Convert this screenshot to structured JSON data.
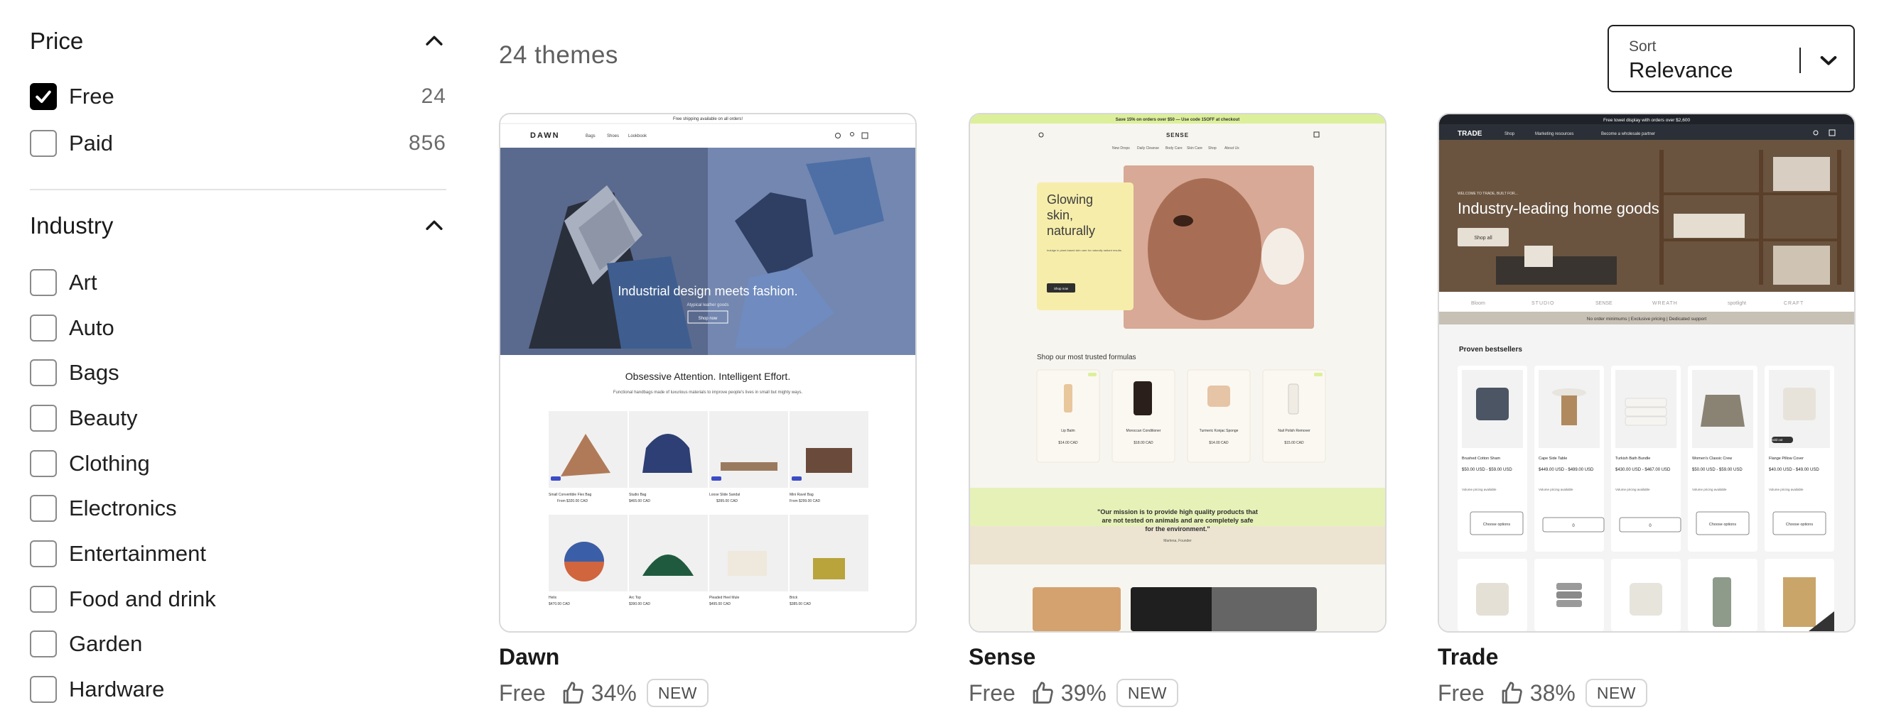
{
  "filters": {
    "price": {
      "title": "Price",
      "options": [
        {
          "label": "Free",
          "count": "24",
          "checked": true
        },
        {
          "label": "Paid",
          "count": "856",
          "checked": false
        }
      ]
    },
    "industry": {
      "title": "Industry",
      "options": [
        {
          "label": "Art"
        },
        {
          "label": "Auto"
        },
        {
          "label": "Bags"
        },
        {
          "label": "Beauty"
        },
        {
          "label": "Clothing"
        },
        {
          "label": "Electronics"
        },
        {
          "label": "Entertainment"
        },
        {
          "label": "Food and drink"
        },
        {
          "label": "Garden"
        },
        {
          "label": "Hardware"
        }
      ]
    }
  },
  "results": {
    "count_label": "24 themes"
  },
  "sort": {
    "caption": "Sort",
    "value": "Relevance"
  },
  "themes": [
    {
      "name": "Dawn",
      "price": "Free",
      "rating": "34%",
      "badge": "NEW",
      "preview": {
        "announcement": "Free shipping available on all orders!",
        "logo": "DAWN",
        "nav": [
          "Bags",
          "Shoes",
          "Lookbook"
        ],
        "hero_title": "Industrial design meets fashion.",
        "hero_sub": "Atypical leather goods",
        "hero_button": "Shop now",
        "section_title": "Obsessive Attention. Intelligent Effort.",
        "section_text": "Functional handbags made of luxurious materials to improve people's lives in small but mighty ways.",
        "products": [
          {
            "name": "Small Convertible Flex Bag",
            "price": "From $320.00 CAD"
          },
          {
            "name": "Studio Bag",
            "price": "$465.00 CAD"
          },
          {
            "name": "Loose Slide Sandal",
            "price": "$395.00 CAD"
          },
          {
            "name": "Mini Ravel Bag",
            "price": "From $299.00 CAD"
          },
          {
            "name": "Helix",
            "price": "$470.00 CAD"
          },
          {
            "name": "Arc Top",
            "price": "$390.00 CAD"
          },
          {
            "name": "Pleaded Heel Mule",
            "price": "$495.00 CAD"
          },
          {
            "name": "Brick",
            "price": "$385.00 CAD"
          }
        ]
      }
    },
    {
      "name": "Sense",
      "price": "Free",
      "rating": "39%",
      "badge": "NEW",
      "preview": {
        "announcement": "Save 15% on orders over $50 — Use code 15OFF at checkout",
        "logo": "SENSE",
        "nav": [
          "New Drops",
          "Daily Cleanse",
          "Body Care",
          "Skin Care",
          "Shop",
          "About Us"
        ],
        "hero_title_lines": [
          "Glowing",
          "skin,",
          "naturally"
        ],
        "hero_text": "Indulge in plant-based skin care for naturally radiant results.",
        "hero_button": "Shop now",
        "section_title": "Shop our most trusted formulas",
        "products": [
          {
            "name": "Lip Balm",
            "price": "$14.00 CAD"
          },
          {
            "name": "Moroccan Conditioner",
            "price": "$18.00 CAD"
          },
          {
            "name": "Turmeric Konjac Sponge",
            "price": "$14.00 CAD"
          },
          {
            "name": "Nail Polish Remover",
            "price": "$15.00 CAD"
          }
        ],
        "quote_lines": [
          "\"Our mission is to provide high quality products that",
          "are not tested on animals and are completely safe",
          "for the environment.\""
        ],
        "quote_author": "Marlena, Founder"
      }
    },
    {
      "name": "Trade",
      "price": "Free",
      "rating": "38%",
      "badge": "NEW",
      "preview": {
        "announcement": "Free towel display with orders over $2,600",
        "logo": "TRADE",
        "nav": [
          "Shop",
          "Marketing resources",
          "Become a wholesale partner"
        ],
        "kicker": "WELCOME TO TRADE, BUILT FOR...",
        "hero_title": "Industry-leading home goods",
        "hero_button": "Shop all",
        "brands": [
          "Bloom",
          "STUDIO",
          "SENSE",
          "WREATH",
          "spotlight",
          "CRAFT"
        ],
        "strip": "No order minimums | Exclusive pricing | Dedicated support",
        "section_title": "Proven bestsellers",
        "products": [
          {
            "name": "Brushed Cotton Sham",
            "price": "$50.00 USD - $59.00 USD",
            "button": "Choose options"
          },
          {
            "name": "Cape Side Table",
            "price": "$449.00 USD - $499.00 USD",
            "button": "0"
          },
          {
            "name": "Turkish Bath Bundle",
            "price": "$430.00 USD - $467.00 USD",
            "button": "0"
          },
          {
            "name": "Women's Classic Crew",
            "price": "$50.00 USD - $59.00 USD",
            "button": "Choose options"
          },
          {
            "name": "Flange Pillow Cover",
            "price": "$40.00 USD - $49.00 USD",
            "button": "Choose options"
          }
        ],
        "volume_label": "Volume pricing available",
        "sold_out": "Sold out"
      }
    }
  ]
}
